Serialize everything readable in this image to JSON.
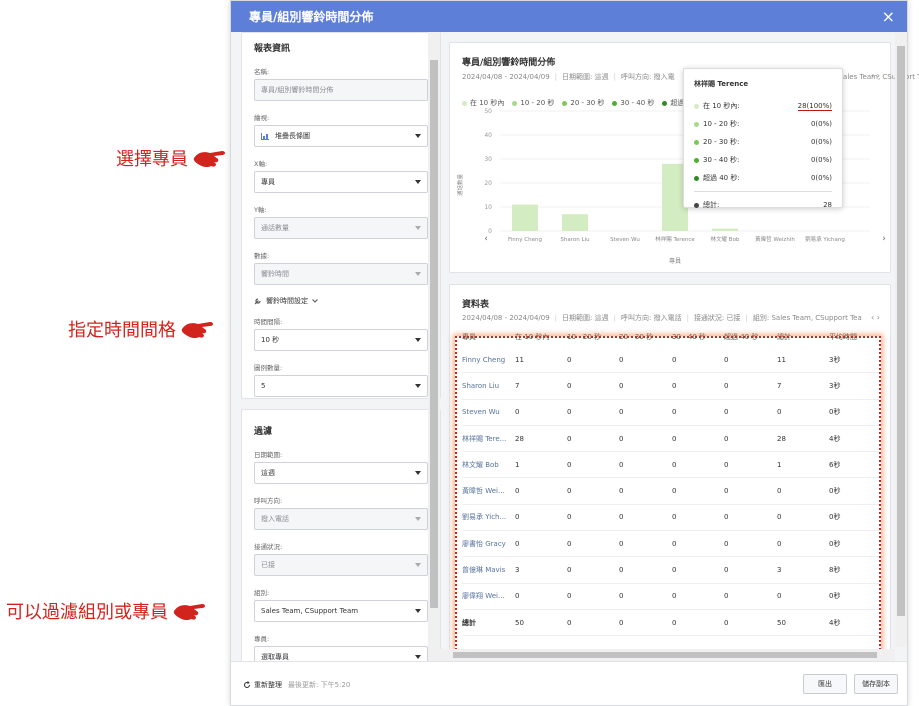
{
  "annotations": {
    "select_agent": "選擇專員",
    "time_interval": "指定時間間格",
    "filter": "可以過濾組別或專員"
  },
  "dialog": {
    "title": "專員/組別響鈴時間分佈",
    "close": "×"
  },
  "report_info": {
    "heading": "報表資訊",
    "name_label": "名稱:",
    "name_placeholder": "專員/組別響鈴時間分佈",
    "template_label": "繪視:",
    "template_value": "堆疊長條圖",
    "x_label": "X軸:",
    "x_value": "專員",
    "y_label": "Y軸:",
    "y_value": "通話數量",
    "data_label": "數據:",
    "data_value": "響鈴時間",
    "ring_setting": "響鈴時間設定",
    "interval_label": "時間間隔:",
    "interval_value": "10 秒",
    "count_label": "圖例數量:",
    "count_value": "5"
  },
  "filter": {
    "heading": "過濾",
    "date_label": "日期範圍:",
    "date_value": "這週",
    "direction_label": "呼叫方向:",
    "direction_value": "撥入電話",
    "status_label": "接通狀況:",
    "status_value": "已接",
    "group_label": "組別:",
    "group_value": "Sales Team, CSupport Team",
    "agent_label": "專員:",
    "agent_placeholder": "選取專員"
  },
  "chart_panel": {
    "title": "專員/組別響鈴時間分佈",
    "meta": [
      "2024/04/08 - 2024/04/09",
      "日期範圍: 這週",
      "呼叫方向: 撥入電"
    ],
    "meta_tail": "組別: Sales Team, CSupport Tea",
    "nav": "‹  ›",
    "legend": [
      {
        "label": "在 10 秒內",
        "color": "#d4ecc2"
      },
      {
        "label": "10 - 20 秒",
        "color": "#a6d98a"
      },
      {
        "label": "20 - 30 秒",
        "color": "#7cc957"
      },
      {
        "label": "30 - 40 秒",
        "color": "#4fae2f"
      },
      {
        "label": "超過",
        "color": "#2e8c22"
      }
    ],
    "ylabel": "通話數量",
    "xlabel": "專員",
    "scroll_left": "‹",
    "scroll_right": "›"
  },
  "chart_data": {
    "type": "bar",
    "categories": [
      "Finny Cheng",
      "Sharon Liu",
      "Steven Wu",
      "林祥賜 Terence",
      "林文耀 Bob",
      "黃暐哲 Weizhih",
      "劉易承 Yichang"
    ],
    "series": [
      {
        "name": "在 10 秒內",
        "values": [
          11,
          7,
          0,
          28,
          1,
          0,
          0
        ]
      }
    ],
    "yticks": [
      0,
      10,
      20,
      30,
      40,
      50
    ],
    "ylim": [
      0,
      50
    ],
    "xlabel": "專員",
    "ylabel": "通話數量"
  },
  "tooltip": {
    "title": "林祥賜 Terence",
    "rows": [
      {
        "label": "在 10 秒內:",
        "value": "28(100%)",
        "color": "#d4ecc2"
      },
      {
        "label": "10 - 20 秒:",
        "value": "0(0%)",
        "color": "#a6d98a"
      },
      {
        "label": "20 - 30 秒:",
        "value": "0(0%)",
        "color": "#7cc957"
      },
      {
        "label": "30 - 40 秒:",
        "value": "0(0%)",
        "color": "#4fae2f"
      },
      {
        "label": "超過 40 秒:",
        "value": "0(0%)",
        "color": "#2e8c22"
      }
    ],
    "total_label": "總計:",
    "total_value": "28"
  },
  "table_panel": {
    "title": "資料表",
    "meta": [
      "2024/04/08 - 2024/04/09",
      "日期範圍: 這週",
      "呼叫方向: 撥入電話",
      "接通狀況: 已接",
      "組別: Sales Team, CSupport Tea"
    ],
    "nav": "‹  ›",
    "headers": [
      "專員",
      "在 10 秒內",
      "10 - 20 秒",
      "20 - 30 秒",
      "30 - 40 秒",
      "超過 40 秒",
      "總計",
      "平均時間"
    ],
    "rows": [
      [
        "Finny Cheng",
        "11",
        "0",
        "0",
        "0",
        "0",
        "11",
        "3秒"
      ],
      [
        "Sharon Liu",
        "7",
        "0",
        "0",
        "0",
        "0",
        "7",
        "3秒"
      ],
      [
        "Steven Wu",
        "0",
        "0",
        "0",
        "0",
        "0",
        "0",
        "0秒"
      ],
      [
        "林祥賜 Tere...",
        "28",
        "0",
        "0",
        "0",
        "0",
        "28",
        "4秒"
      ],
      [
        "林文耀 Bob",
        "1",
        "0",
        "0",
        "0",
        "0",
        "1",
        "6秒"
      ],
      [
        "黃暐哲 Wei...",
        "0",
        "0",
        "0",
        "0",
        "0",
        "0",
        "0秒"
      ],
      [
        "劉易承 Yich...",
        "0",
        "0",
        "0",
        "0",
        "0",
        "0",
        "0秒"
      ],
      [
        "廖書怡 Gracy",
        "0",
        "0",
        "0",
        "0",
        "0",
        "0",
        "0秒"
      ],
      [
        "曾億琳 Mavis",
        "3",
        "0",
        "0",
        "0",
        "0",
        "3",
        "8秒"
      ],
      [
        "廖偉翔 Wei...",
        "0",
        "0",
        "0",
        "0",
        "0",
        "0",
        "0秒"
      ],
      [
        "總計",
        "50",
        "0",
        "0",
        "0",
        "0",
        "50",
        "4秒"
      ]
    ]
  },
  "footer": {
    "refresh": "重新整理",
    "last_update": "最後更新: 下午5:20",
    "export": "匯出",
    "save_copy": "儲存副本"
  }
}
